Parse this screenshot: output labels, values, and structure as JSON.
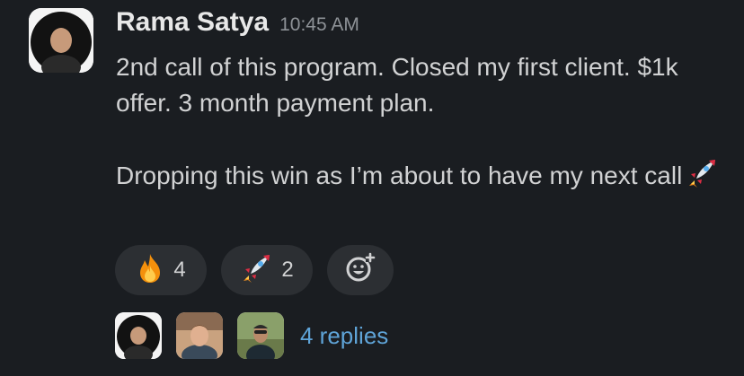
{
  "message": {
    "author": "Rama Satya",
    "timestamp": "10:45 AM",
    "lines": [
      "2nd call of this program. Closed my first client. $1k offer. 3 month payment plan.",
      "Dropping this win as I’m about to have my next call"
    ],
    "trailing_emoji": "rocket-emoji"
  },
  "reactions": [
    {
      "emoji": "fire-emoji",
      "count": "4"
    },
    {
      "emoji": "rocket-emoji",
      "count": "2"
    }
  ],
  "add_reaction_icon": "add-reaction-icon",
  "thread": {
    "participant_avatars": [
      "avatar-rama-satya",
      "avatar-replier-2",
      "avatar-replier-3"
    ],
    "replies_label": "4 replies"
  },
  "colors": {
    "background": "#1a1d21",
    "reaction_bg": "#2c2f33",
    "link": "#5fa4d8",
    "timestamp": "#8e9297"
  }
}
